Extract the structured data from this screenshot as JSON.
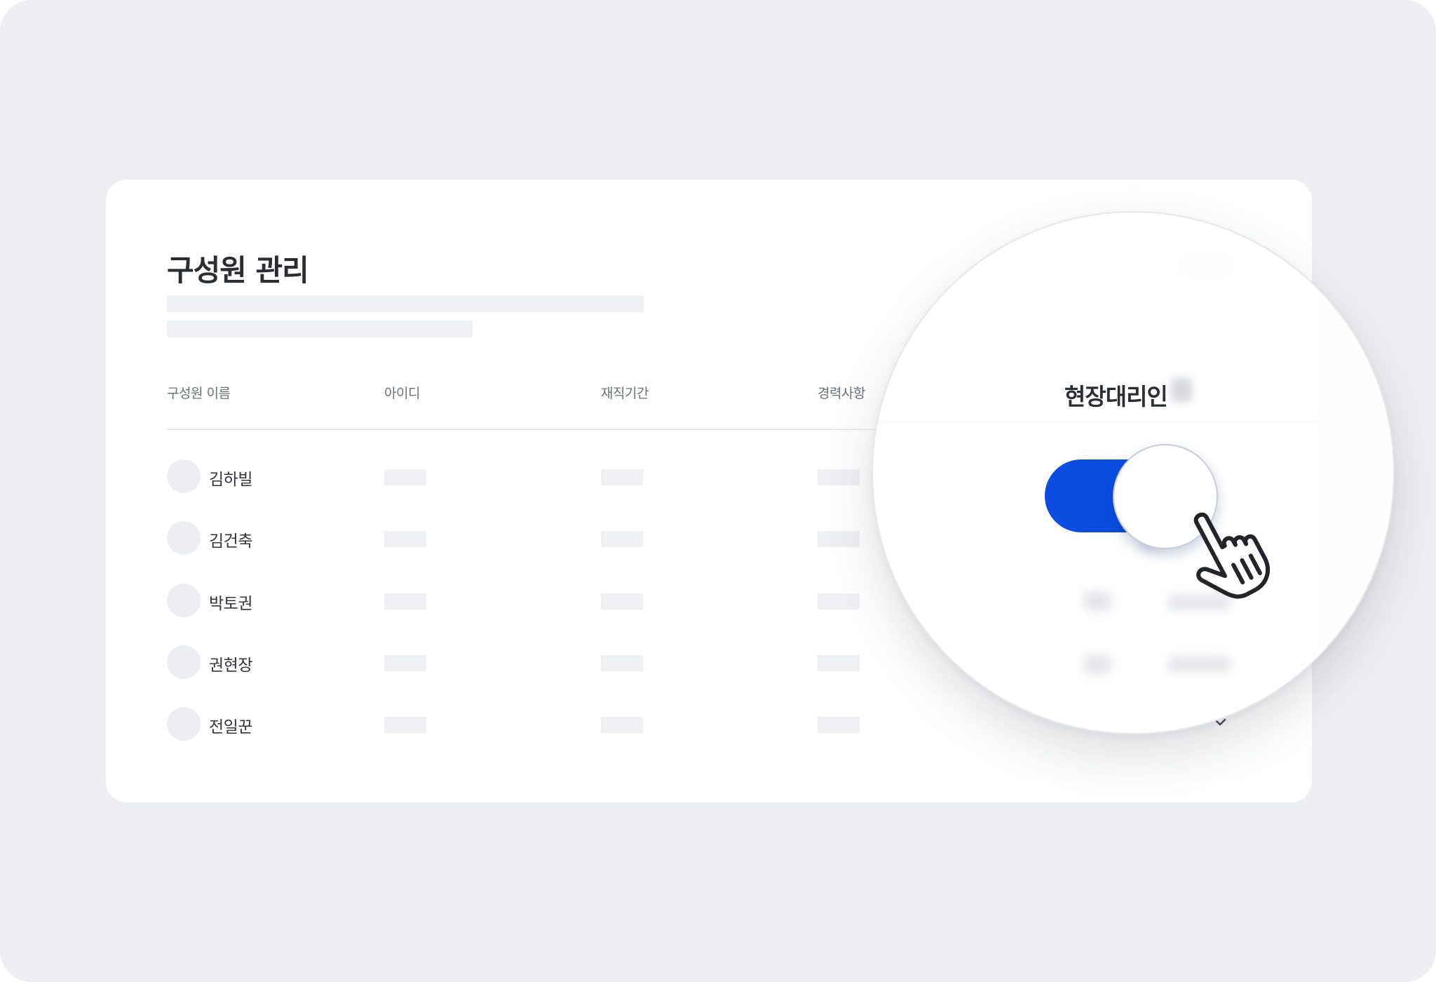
{
  "page": {
    "title": "구성원 관리"
  },
  "table": {
    "columns": [
      "구성원 이름",
      "아이디",
      "재직기간",
      "경력사항"
    ],
    "rows": [
      {
        "name": "김하빌"
      },
      {
        "name": "김건축"
      },
      {
        "name": "박토권"
      },
      {
        "name": "권현장"
      },
      {
        "name": "전일꾼"
      }
    ]
  },
  "magnifier": {
    "column_label": "현장대리인",
    "toggle_state": "on"
  },
  "icons": {
    "cursor": "hand-pointer-icon",
    "expand": "chevron-down-icon"
  },
  "colors": {
    "background": "#eeeff2",
    "card": "#ffffff",
    "accent": "#0a4de0",
    "title_text": "#2a2d34"
  }
}
